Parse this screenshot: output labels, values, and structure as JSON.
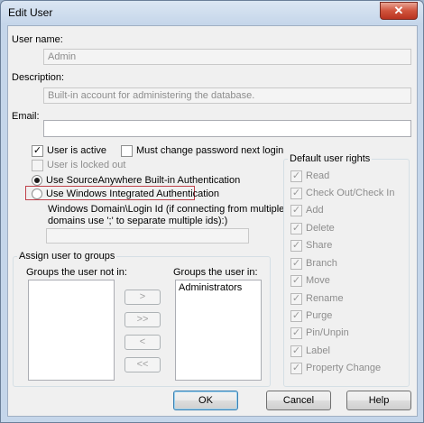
{
  "window": {
    "title": "Edit User",
    "close_glyph": "✕"
  },
  "user_name": {
    "label": "User name:",
    "value": "Admin"
  },
  "description": {
    "label": "Description:",
    "value": "Built-in account for administering the database."
  },
  "email": {
    "label": "Email:",
    "value": ""
  },
  "options": {
    "user_is_active": {
      "label": "User is active",
      "checked": true
    },
    "must_change_password": {
      "label": "Must change password next login",
      "checked": false
    },
    "user_locked_out": {
      "label": "User is locked out",
      "checked": false
    }
  },
  "auth": {
    "builtin": {
      "label": "Use SourceAnywhere Built-in Authentication",
      "selected": true
    },
    "windows": {
      "label": "Use Windows Integrated Authentication",
      "selected": false
    },
    "windows_login_hint_line1": "Windows Domain\\Login Id (if connecting from multiple",
    "windows_login_hint_line2": "domains use ';' to separate multiple ids):)",
    "windows_login_value": ""
  },
  "groups": {
    "title": "Assign user to groups",
    "not_in_label": "Groups the user not in:",
    "in_label": "Groups the user in:",
    "not_in_items": [],
    "in_items": [
      "Administrators"
    ],
    "add_button": ">",
    "add_all_button": ">>",
    "remove_button": "<",
    "remove_all_button": "<<"
  },
  "default_rights": {
    "title": "Default user rights",
    "items": [
      "Read",
      "Check Out/Check In",
      "Add",
      "Delete",
      "Share",
      "Branch",
      "Move",
      "Rename",
      "Purge",
      "Pin/Unpin",
      "Label",
      "Property Change"
    ]
  },
  "buttons": {
    "ok": "OK",
    "cancel": "Cancel",
    "help": "Help"
  },
  "check_glyph": "✓",
  "colors": {
    "highlight_border": "#c0404a",
    "disabled_text": "#8d8d8d"
  }
}
